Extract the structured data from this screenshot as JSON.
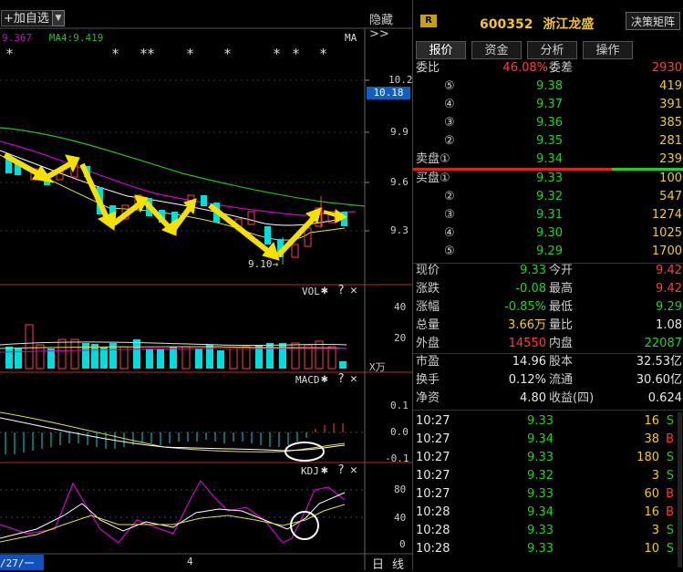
{
  "toolbar": {
    "add_label": "+加自选",
    "dropdown": "▼",
    "hide_label": "隐藏>>"
  },
  "ma_legend": {
    "ma_a": "9.367",
    "ma4": "MA4:9.419",
    "ma_tag": "MA"
  },
  "price_axis": {
    "ticks": [
      "10.2",
      "9.9",
      "9.6",
      "9.3"
    ],
    "current": "10.18"
  },
  "annotation": {
    "low_label": "9.10→"
  },
  "vol_panel": {
    "title": "VOL",
    "ticks": [
      "40",
      "20"
    ],
    "unit": "X万"
  },
  "macd_panel": {
    "title": "MACD",
    "ticks": [
      "0.1",
      "0.0",
      "-0.1"
    ]
  },
  "kdj_panel": {
    "title": "KDJ",
    "ticks": [
      "80",
      "40",
      "0"
    ]
  },
  "bottom_bar": {
    "date": "/27/一",
    "mid": "4",
    "period_a": "日",
    "period_b": "线"
  },
  "panel_icons": {
    "gear": "✱",
    "help": "?",
    "close": "✕"
  },
  "quote": {
    "badge": "R",
    "code": "600352",
    "name": "浙江龙盛",
    "decision_button": "决策矩阵",
    "tabs": [
      "报价",
      "资金",
      "分析",
      "操作"
    ],
    "weibi_label": "委比",
    "weibi": "46.08%",
    "weicha_label": "委差",
    "weicha": "2930",
    "asks": [
      {
        "level": "⑤",
        "price": "9.38",
        "vol": "419"
      },
      {
        "level": "④",
        "price": "9.37",
        "vol": "391"
      },
      {
        "level": "③",
        "price": "9.36",
        "vol": "385"
      },
      {
        "level": "②",
        "price": "9.35",
        "vol": "281"
      },
      {
        "level": "卖盘①",
        "price": "9.34",
        "vol": "239"
      }
    ],
    "bids": [
      {
        "level": "买盘①",
        "price": "9.33",
        "vol": "100"
      },
      {
        "level": "②",
        "price": "9.32",
        "vol": "547"
      },
      {
        "level": "③",
        "price": "9.31",
        "vol": "1274"
      },
      {
        "level": "④",
        "price": "9.30",
        "vol": "1025"
      },
      {
        "level": "⑤",
        "price": "9.29",
        "vol": "1700"
      }
    ],
    "stats": [
      {
        "l1": "现价",
        "v1": "9.33",
        "c1": "green",
        "l2": "今开",
        "v2": "9.42",
        "c2": "red"
      },
      {
        "l1": "涨跌",
        "v1": "-0.08",
        "c1": "green",
        "l2": "最高",
        "v2": "9.42",
        "c2": "red"
      },
      {
        "l1": "涨幅",
        "v1": "-0.85%",
        "c1": "green",
        "l2": "最低",
        "v2": "9.29",
        "c2": "green"
      },
      {
        "l1": "总量",
        "v1": "3.66万",
        "c1": "yellow",
        "l2": "量比",
        "v2": "1.08",
        "c2": "white"
      },
      {
        "l1": "外盘",
        "v1": "14550",
        "c1": "red",
        "l2": "内盘",
        "v2": "22087",
        "c2": "green"
      }
    ],
    "fund": [
      {
        "l1": "市盈",
        "v1": "14.96",
        "l2": "股本",
        "v2": "32.53亿"
      },
      {
        "l1": "换手",
        "v1": "0.12%",
        "l2": "流通",
        "v2": "30.60亿"
      },
      {
        "l1": "净资",
        "v1": "4.80",
        "l2": "收益(四)",
        "v2": "0.624"
      }
    ],
    "ticks": [
      {
        "time": "10:27",
        "price": "9.33",
        "vol": "16",
        "side": "S"
      },
      {
        "time": "10:27",
        "price": "9.34",
        "vol": "38",
        "side": "B"
      },
      {
        "time": "10:27",
        "price": "9.33",
        "vol": "180",
        "side": "S"
      },
      {
        "time": "10:27",
        "price": "9.32",
        "vol": "3",
        "side": "S"
      },
      {
        "time": "10:27",
        "price": "9.33",
        "vol": "60",
        "side": "B"
      },
      {
        "time": "10:28",
        "price": "9.34",
        "vol": "16",
        "side": "B"
      },
      {
        "time": "10:28",
        "price": "9.33",
        "vol": "3",
        "side": "S"
      },
      {
        "time": "10:28",
        "price": "9.33",
        "vol": "10",
        "side": "S"
      }
    ]
  }
}
